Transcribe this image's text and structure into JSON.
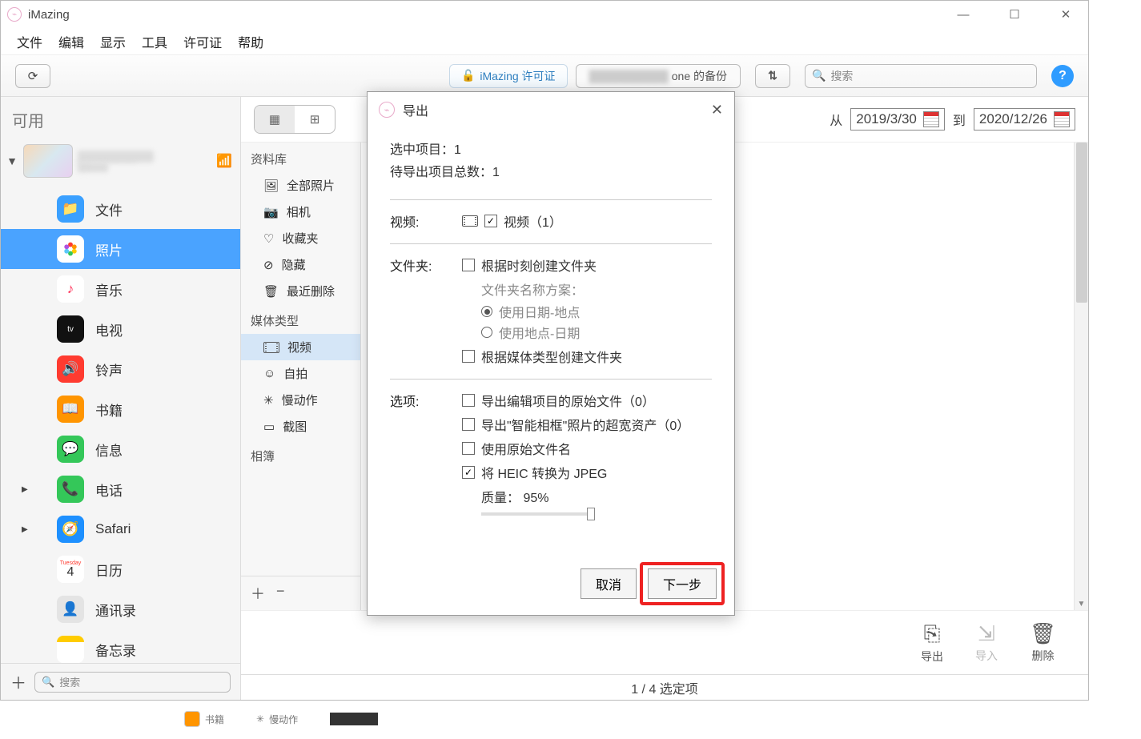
{
  "app": {
    "title": "iMazing"
  },
  "menubar": [
    "文件",
    "编辑",
    "显示",
    "工具",
    "许可证",
    "帮助"
  ],
  "toolbar": {
    "license_label": "iMazing 许可证",
    "device_pill_suffix": "one 的备份",
    "search_placeholder": "搜索"
  },
  "sidebar": {
    "header": "可用",
    "device_name_masked": "████████ h...",
    "device_sub_masked": "██OS..",
    "items": [
      {
        "label": "文件",
        "icon_bg": "#3aa0ff",
        "icon": "folder"
      },
      {
        "label": "照片",
        "icon_bg": "#ffffff",
        "icon": "photos",
        "active": true,
        "active_bg": "#4aa3ff"
      },
      {
        "label": "音乐",
        "icon_bg": "#ffffff",
        "icon": "music"
      },
      {
        "label": "电视",
        "icon_bg": "#111",
        "icon": "tv"
      },
      {
        "label": "铃声",
        "icon_bg": "#ff3b30",
        "icon": "sound"
      },
      {
        "label": "书籍",
        "icon_bg": "#ff9500",
        "icon": "book"
      },
      {
        "label": "信息",
        "icon_bg": "#34c759",
        "icon": "msg"
      },
      {
        "label": "电话",
        "icon_bg": "#34c759",
        "icon": "phone",
        "arrow": true
      },
      {
        "label": "Safari",
        "icon_bg": "#1e90ff",
        "icon": "safari",
        "arrow": true
      },
      {
        "label": "日历",
        "icon_bg": "#ffffff",
        "icon": "cal",
        "badge_top": "Tuesday",
        "badge_num": "4"
      },
      {
        "label": "通讯录",
        "icon_bg": "#e4e4e4",
        "icon": "contacts"
      },
      {
        "label": "备忘录",
        "icon_bg": "#ffffff",
        "icon": "notes",
        "top_stripe": "#ffcc00"
      }
    ],
    "footer_search": "搜索"
  },
  "library": {
    "sections": [
      {
        "title": "资料库",
        "items": [
          {
            "label": "全部照片",
            "glyph": "🖼"
          },
          {
            "label": "相机",
            "glyph": "📷"
          },
          {
            "label": "收藏夹",
            "glyph": "♡"
          },
          {
            "label": "隐藏",
            "glyph": "⊘"
          },
          {
            "label": "最近删除",
            "glyph": "🗑"
          }
        ]
      },
      {
        "title": "媒体类型",
        "items": [
          {
            "label": "视频",
            "glyph": "film",
            "selected": true
          },
          {
            "label": "自拍",
            "glyph": "☺"
          },
          {
            "label": "慢动作",
            "glyph": "✳"
          },
          {
            "label": "截图",
            "glyph": "▭"
          }
        ]
      },
      {
        "title": "相簿",
        "items": []
      }
    ]
  },
  "date_range": {
    "from_label": "从",
    "from": "2019/3/30",
    "to_label": "到",
    "to": "2020/12/26"
  },
  "actions": {
    "export": "导出",
    "import": "导入",
    "delete": "删除"
  },
  "status": "1 / 4 选定项",
  "dialog": {
    "title": "导出",
    "selected_label": "选中项目：",
    "selected_count": "1",
    "total_label": "待导出项目总数：",
    "total_count": "1",
    "video_label": "视频:",
    "video_check": "视频（1）",
    "folder_label": "文件夹:",
    "folder_by_moment": "根据时刻创建文件夹",
    "folder_scheme_label": "文件夹名称方案：",
    "folder_scheme_opt1": "使用日期-地点",
    "folder_scheme_opt2": "使用地点-日期",
    "folder_by_media": "根据媒体类型创建文件夹",
    "options_label": "选项:",
    "opt_export_raw": "导出编辑项目的原始文件（0）",
    "opt_smartframe": "导出\"智能相框\"照片的超宽资产（0）",
    "opt_origname": "使用原始文件名",
    "opt_heic": "将 HEIC 转换为 JPEG",
    "quality_label": "质量：",
    "quality_value": "95%",
    "cancel": "取消",
    "next": "下一步"
  },
  "ext": {
    "a": "书籍",
    "b": "慢动作"
  }
}
